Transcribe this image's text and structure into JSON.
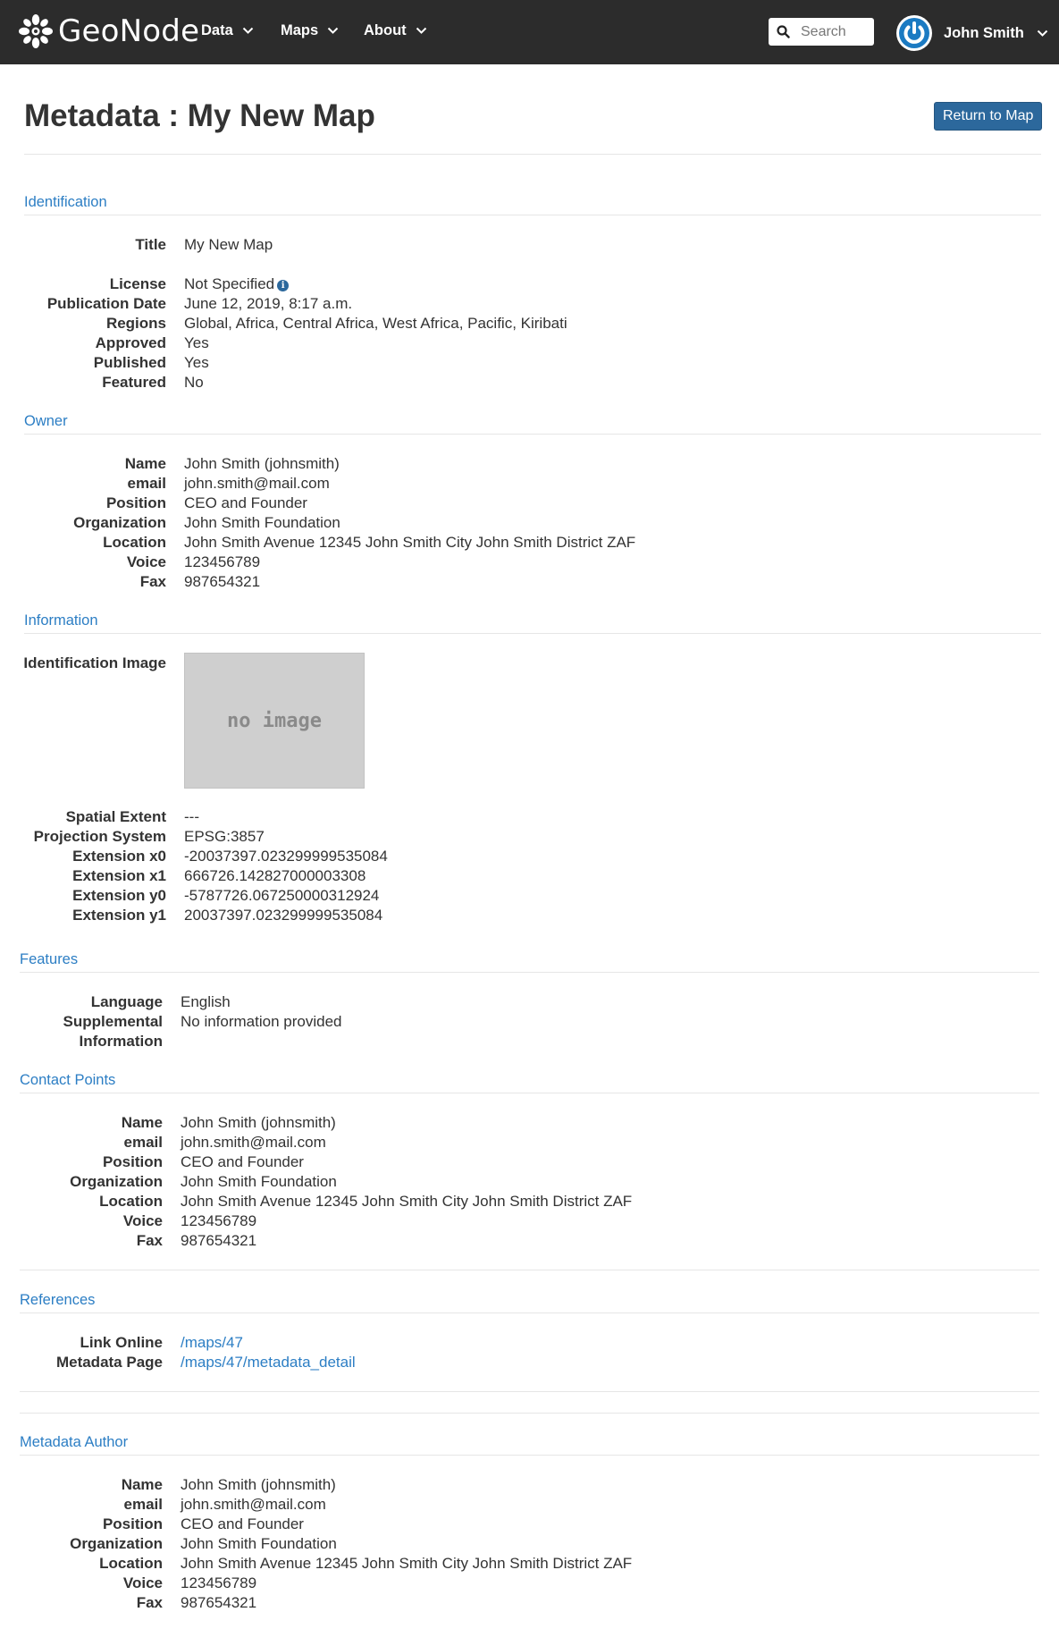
{
  "navbar": {
    "brand": "GeoNode",
    "menu": [
      "Data",
      "Maps",
      "About"
    ],
    "search_placeholder": "Search",
    "user_name": "John Smith"
  },
  "header": {
    "title": "Metadata : My New Map",
    "return_button": "Return to Map"
  },
  "identification": {
    "heading": "Identification",
    "title_label": "Title",
    "title_value": "My New Map",
    "license_label": "License",
    "license_value": "Not Specified",
    "pubdate_label": "Publication Date",
    "pubdate_value": "June 12, 2019, 8:17 a.m.",
    "regions_label": "Regions",
    "regions_value": "Global, Africa, Central Africa, West Africa, Pacific, Kiribati",
    "approved_label": "Approved",
    "approved_value": "Yes",
    "published_label": "Published",
    "published_value": "Yes",
    "featured_label": "Featured",
    "featured_value": "No"
  },
  "owner": {
    "heading": "Owner",
    "labels": [
      "Name",
      "email",
      "Position",
      "Organization",
      "Location",
      "Voice",
      "Fax"
    ],
    "values": [
      "John Smith (johnsmith)",
      "john.smith@mail.com",
      "CEO and Founder",
      "John Smith Foundation",
      "John Smith Avenue 12345 John Smith City John Smith District ZAF",
      "123456789",
      "987654321"
    ]
  },
  "information": {
    "heading": "Information",
    "image_label": "Identification Image",
    "no_image_text": "no image",
    "labels": [
      "Spatial Extent",
      "Projection System",
      "Extension x0",
      "Extension x1",
      "Extension y0",
      "Extension y1"
    ],
    "values": [
      "---",
      "EPSG:3857",
      "-20037397.023299999535084",
      "666726.142827000003308",
      "-5787726.067250000312924",
      "20037397.023299999535084"
    ]
  },
  "features": {
    "heading": "Features",
    "language_label": "Language",
    "language_value": "English",
    "supplemental_label_1": "Supplemental",
    "supplemental_label_2": "Information",
    "supplemental_value": "No information provided"
  },
  "contact_points": {
    "heading": "Contact Points",
    "labels": [
      "Name",
      "email",
      "Position",
      "Organization",
      "Location",
      "Voice",
      "Fax"
    ],
    "values": [
      "John Smith (johnsmith)",
      "john.smith@mail.com",
      "CEO and Founder",
      "John Smith Foundation",
      "John Smith Avenue 12345 John Smith City John Smith District ZAF",
      "123456789",
      "987654321"
    ]
  },
  "references": {
    "heading": "References",
    "link_online_label": "Link Online",
    "link_online_value": "/maps/47",
    "metadata_page_label": "Metadata Page",
    "metadata_page_value": "/maps/47/metadata_detail"
  },
  "metadata_author": {
    "heading": "Metadata Author",
    "labels": [
      "Name",
      "email",
      "Position",
      "Organization",
      "Location",
      "Voice",
      "Fax"
    ],
    "values": [
      "John Smith (johnsmith)",
      "john.smith@mail.com",
      "CEO and Founder",
      "John Smith Foundation",
      "John Smith Avenue 12345 John Smith City John Smith District ZAF",
      "123456789",
      "987654321"
    ]
  }
}
